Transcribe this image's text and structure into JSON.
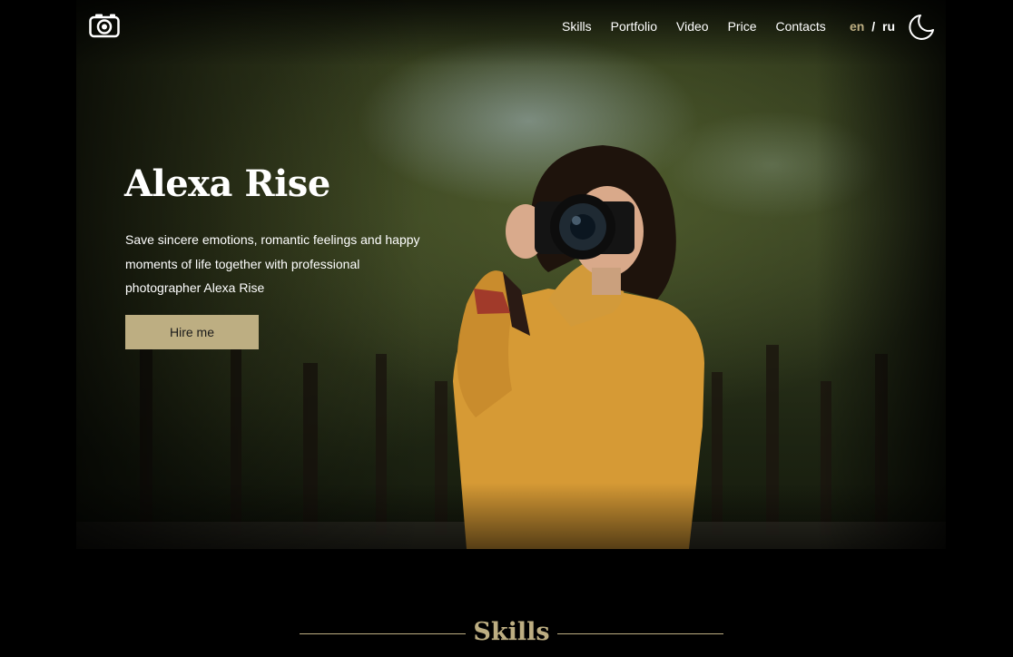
{
  "header": {
    "logo_icon": "camera-icon",
    "nav": [
      {
        "label": "Skills"
      },
      {
        "label": "Portfolio"
      },
      {
        "label": "Video"
      },
      {
        "label": "Price"
      },
      {
        "label": "Contacts"
      }
    ],
    "languages": {
      "en": "en",
      "separator": "/",
      "ru": "ru",
      "active": "en"
    },
    "theme_icon": "moon-icon"
  },
  "hero": {
    "title": "Alexa Rise",
    "description": "Save sincere emotions, romantic feelings and happy moments of life together with professional photographer Alexa Rise",
    "button_label": "Hire me"
  },
  "skills": {
    "title": "Skills"
  },
  "colors": {
    "background": "#000000",
    "accent": "#bdae82",
    "text": "#ffffff"
  }
}
